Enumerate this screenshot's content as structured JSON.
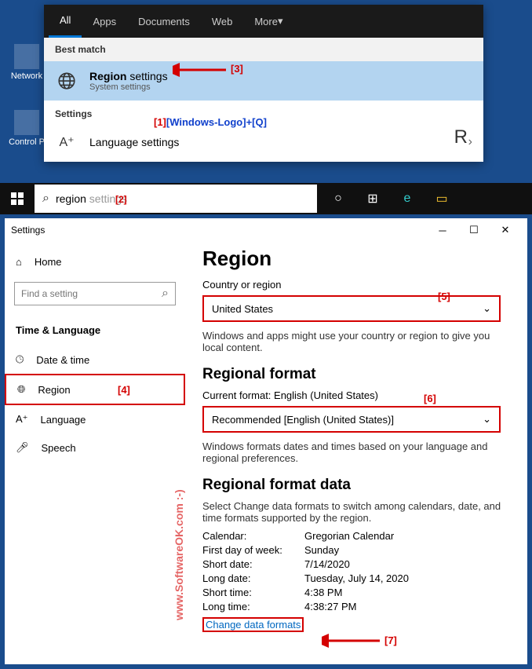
{
  "desktop": {
    "network_label": "Network",
    "controlpanel_label": "Control P"
  },
  "search": {
    "tabs": [
      "All",
      "Apps",
      "Documents",
      "Web",
      "More"
    ],
    "best_match_label": "Best match",
    "result_title_prefix": "Region",
    "result_title_suffix": " settings",
    "result_sub": "System settings",
    "settings_label": "Settings",
    "language_settings": "Language settings",
    "right_letter": "R",
    "input_typed": "region",
    "input_ghost": " settings"
  },
  "annotations": {
    "a1": "[1]",
    "a1_text": "[Windows-Logo]+[Q]",
    "a2": "[2]",
    "a3": "[3]",
    "a4": "[4]",
    "a5": "[5]",
    "a6": "[6]",
    "a7": "[7]"
  },
  "settings": {
    "window_title": "Settings",
    "home": "Home",
    "find_placeholder": "Find a setting",
    "category": "Time & Language",
    "nav": {
      "datetime": "Date & time",
      "region": "Region",
      "language": "Language",
      "speech": "Speech"
    },
    "page": {
      "title": "Region",
      "country_label": "Country or region",
      "country_value": "United States",
      "country_help": "Windows and apps might use your country or region to give you local content.",
      "regional_format_title": "Regional format",
      "current_format_label": "Current format: English (United States)",
      "format_value": "Recommended [English (United States)]",
      "format_help": "Windows formats dates and times based on your language and regional preferences.",
      "format_data_title": "Regional format data",
      "format_data_help": "Select Change data formats to switch among calendars, date, and time formats supported by the region.",
      "rows": {
        "calendar_l": "Calendar:",
        "calendar_v": "Gregorian Calendar",
        "firstday_l": "First day of week:",
        "firstday_v": "Sunday",
        "shortdate_l": "Short date:",
        "shortdate_v": "7/14/2020",
        "longdate_l": "Long date:",
        "longdate_v": "Tuesday, July 14, 2020",
        "shorttime_l": "Short time:",
        "shorttime_v": "4:38 PM",
        "longtime_l": "Long time:",
        "longtime_v": "4:38:27 PM"
      },
      "change_link": "Change data formats"
    }
  },
  "watermark": "www.SoftwareOK.com :-)"
}
